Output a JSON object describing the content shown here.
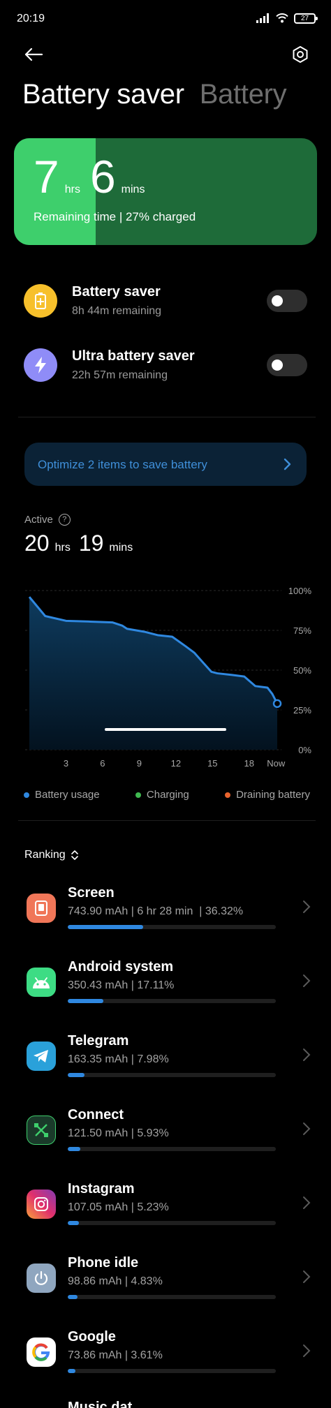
{
  "status_bar": {
    "time": "20:19",
    "battery_level": "27"
  },
  "header": {
    "title": "Battery saver",
    "alt_tab": "Battery"
  },
  "remaining": {
    "hours": "7",
    "hours_unit": "hrs",
    "mins": "6",
    "mins_unit": "mins",
    "subtitle": "Remaining time | 27% charged",
    "charge_fraction": 0.27,
    "colors": {
      "fill": "#3ecf6c",
      "track": "#1e6b39"
    }
  },
  "modes": [
    {
      "title": "Battery saver",
      "subtitle": "8h 44m remaining",
      "enabled": false,
      "icon": "battery-plus-icon",
      "color": "#f7c02b"
    },
    {
      "title": "Ultra battery saver",
      "subtitle": "22h 57m remaining",
      "enabled": false,
      "icon": "lightning-icon",
      "color": "#8f8cf7"
    }
  ],
  "optimize": {
    "label": "Optimize 2 items to save battery"
  },
  "active": {
    "label": "Active",
    "hours": "20",
    "hours_unit": "hrs",
    "mins": "19",
    "mins_unit": "mins"
  },
  "chart_data": {
    "type": "area",
    "x_ticks": [
      "3",
      "6",
      "9",
      "12",
      "15",
      "18",
      "Now"
    ],
    "y_ticks": [
      "100%",
      "75%",
      "50%",
      "25%",
      "0%"
    ],
    "ylim": [
      0,
      100
    ],
    "grid": true,
    "series": [
      {
        "name": "Battery usage",
        "x": [
          0,
          1.3,
          3,
          5,
          6.8,
          7.6,
          8,
          9.5,
          10.5,
          11.7,
          12.8,
          13.5,
          14.2,
          14.9,
          15.4,
          16.6,
          17.6,
          18.5,
          19.5,
          19.9,
          20.3
        ],
        "y": [
          96,
          84,
          81,
          80.5,
          80,
          78,
          76,
          74,
          72,
          71,
          65,
          61,
          55,
          49,
          48,
          47,
          46,
          40,
          39,
          35,
          29
        ]
      }
    ],
    "colors": {
      "line": "#2f88e0",
      "fill_top": "#0e3b5e",
      "fill_bottom": "#03121f"
    }
  },
  "legend": [
    {
      "label": "Battery usage",
      "color": "#2f88e0"
    },
    {
      "label": "Charging",
      "color": "#3fb950"
    },
    {
      "label": "Draining battery",
      "color": "#e8632d"
    }
  ],
  "ranking": {
    "label": "Ranking"
  },
  "apps": [
    {
      "name": "Screen",
      "detail": "743.90 mAh | 6 hr 28 min  | 36.32%",
      "fraction": 0.3632,
      "icon": "screen-icon",
      "color": "#f07658"
    },
    {
      "name": "Android system",
      "detail": "350.43 mAh | 17.11%",
      "fraction": 0.1711,
      "icon": "android-icon",
      "color": "#3ddc84"
    },
    {
      "name": "Telegram",
      "detail": "163.35 mAh | 7.98%",
      "fraction": 0.0798,
      "icon": "telegram-icon",
      "color": "#2aa1da"
    },
    {
      "name": "Connect",
      "detail": "121.50 mAh | 5.93%",
      "fraction": 0.0593,
      "icon": "connect-icon",
      "color": "#1a3a2a"
    },
    {
      "name": "Instagram",
      "detail": "107.05 mAh | 5.23%",
      "fraction": 0.0523,
      "icon": "instagram-icon",
      "color": "#d6249f"
    },
    {
      "name": "Phone idle",
      "detail": "98.86 mAh | 4.83%",
      "fraction": 0.0483,
      "icon": "power-icon",
      "color": "#8fa6bf"
    },
    {
      "name": "Google",
      "detail": "73.86 mAh | 3.61%",
      "fraction": 0.0361,
      "icon": "google-icon",
      "color": "#ffffff"
    }
  ],
  "partial_app": {
    "name": "Music dat"
  }
}
